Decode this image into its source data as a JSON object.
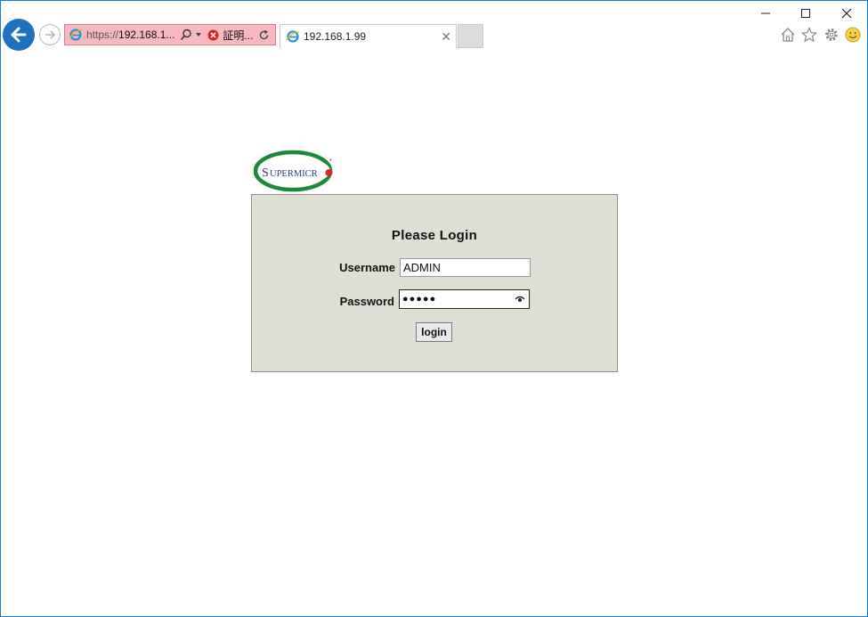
{
  "browser": {
    "address": {
      "url_scheme": "https://",
      "url_rest": "192.168.1...",
      "cert_error": "証明..."
    },
    "tab": {
      "title": "192.168.1.99"
    }
  },
  "logo": {
    "text_s": "S",
    "text_rest": "UPERMICR",
    "reg": "®"
  },
  "login": {
    "title": "Please Login",
    "username_label": "Username",
    "username_value": "ADMIN",
    "password_label": "Password",
    "password_masked": "●●●●●",
    "button_label": "login"
  },
  "colors": {
    "back_button": "#1e73be",
    "address_error_bg": "#f7b8c0",
    "panel_bg": "#deded5",
    "logo_green": "#1a8a3c",
    "logo_blue": "#233a8a",
    "logo_red": "#d42a2a"
  }
}
